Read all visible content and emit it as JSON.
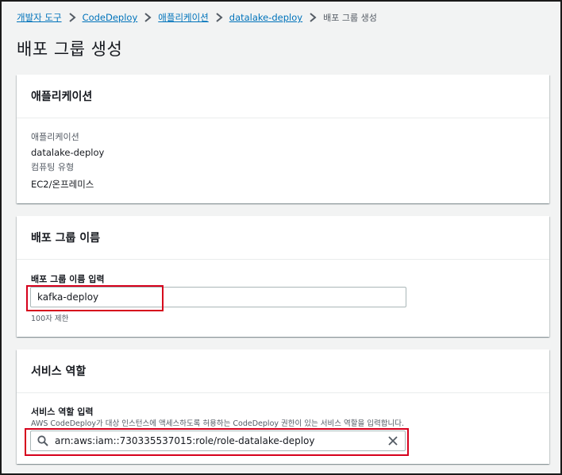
{
  "breadcrumb": {
    "items": [
      "개발자 도구",
      "CodeDeploy",
      "애플리케이션",
      "datalake-deploy"
    ],
    "current": "배포 그룹 생성"
  },
  "page": {
    "title": "배포 그룹 생성"
  },
  "application_section": {
    "header": "애플리케이션",
    "app_label": "애플리케이션",
    "app_value": "datalake-deploy",
    "compute_label": "컴퓨팅 유형",
    "compute_value": "EC2/온프레미스"
  },
  "deployment_group_section": {
    "header": "배포 그룹 이름",
    "field_label": "배포 그룹 이름 입력",
    "input_value": "kafka-deploy",
    "constraint": "100자 제한"
  },
  "service_role_section": {
    "header": "서비스 역할",
    "field_label": "서비스 역할 입력",
    "field_desc": "AWS CodeDeploy가 대상 인스턴스에 액세스하도록 허용하는 CodeDeploy 권한이 있는 서비스 역할을 입력합니다.",
    "input_value": "arn:aws:iam::730335537015:role/role-datalake-deploy"
  },
  "icons": {
    "search": "search-icon",
    "clear": "close-icon",
    "chevron": "chevron-right-icon"
  },
  "colors": {
    "link": "#0073bb",
    "highlight": "#d6001c",
    "background": "#f2f3f3"
  }
}
